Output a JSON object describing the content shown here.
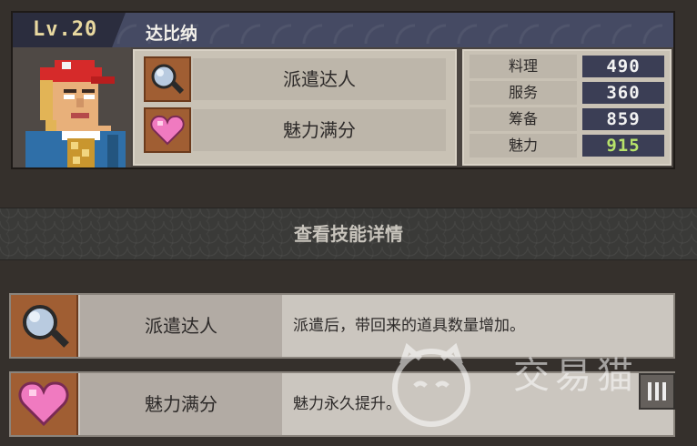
{
  "character": {
    "level": "Lv.20",
    "name": "达比纳"
  },
  "skills": [
    {
      "name": "派遣达人",
      "icon": "magnifier-icon"
    },
    {
      "name": "魅力满分",
      "icon": "heart-icon"
    }
  ],
  "stats": [
    {
      "label": "料理",
      "value": "490",
      "color": "#f2f2f2"
    },
    {
      "label": "服务",
      "value": "360",
      "color": "#f2f2f2"
    },
    {
      "label": "筹备",
      "value": "859",
      "color": "#f2f2f2"
    },
    {
      "label": "魅力",
      "value": "915",
      "color": "#b7e26a"
    }
  ],
  "section": {
    "title": "查看技能详情"
  },
  "details": [
    {
      "name": "派遣达人",
      "description": "派遣后，带回来的道具数量增加。",
      "icon": "magnifier-icon"
    },
    {
      "name": "魅力满分",
      "description": "魅力永久提升。",
      "icon": "heart-icon"
    }
  ],
  "watermark": {
    "text": "交易猫"
  },
  "colors": {
    "header": "#454a63",
    "icon_bg": "#a05e33",
    "stat_value_bg": "#3b3e55",
    "charm_value": "#b7e26a"
  }
}
